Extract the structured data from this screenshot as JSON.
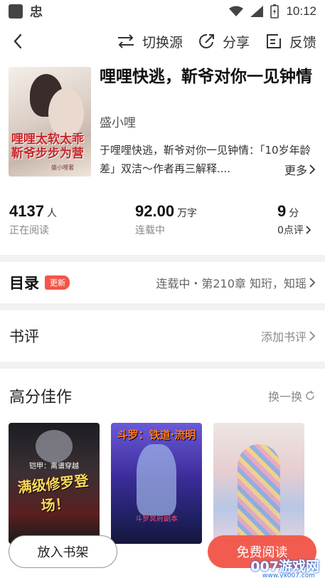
{
  "status_bar": {
    "time": "10:12",
    "app_glyph": "忠"
  },
  "nav": {
    "switch_source": "切换源",
    "share": "分享",
    "feedback": "反馈"
  },
  "book": {
    "title": "哩哩快逃，靳爷对你一见钟情",
    "author": "盛小哩",
    "description": "于哩哩快逃，靳爷对你一见钟情：「10岁年龄差」双洁～作者再三解释....",
    "more": "更多",
    "cover_text": {
      "title": "哩哩太软太乖 靳爷步步为营",
      "author": "盛小哩著"
    }
  },
  "stats": {
    "readers": {
      "value": "4137",
      "unit": "人",
      "label": "正在阅读"
    },
    "words": {
      "value": "92.00",
      "unit": "万字",
      "label": "连载中"
    },
    "score": {
      "value": "9",
      "unit": "分",
      "label": "0点评"
    }
  },
  "toc": {
    "title": "目录",
    "badge": "更新",
    "status": "连载中・第210章 知珩，知瑶"
  },
  "reviews": {
    "title": "书评",
    "add": "添加书评"
  },
  "recommendations": {
    "title": "高分佳作",
    "refresh": "换一换",
    "cards": [
      {
        "cover_title": "满级修罗登场！",
        "cover_sub": "铠甲：离谱穿越"
      },
      {
        "cover_title": "斗罗：铁道·流明",
        "cover_sub": "斗罗冥府副本"
      },
      {
        "cover_title": ""
      }
    ]
  },
  "bottom": {
    "add_to_shelf": "放入书架",
    "free_read": "免费阅读"
  },
  "watermark": {
    "text": "007游戏网",
    "url": "www.yx007.com"
  },
  "colors": {
    "accent": "#f25c4f",
    "badge": "#f2564a",
    "background": "#f2f2f2"
  }
}
